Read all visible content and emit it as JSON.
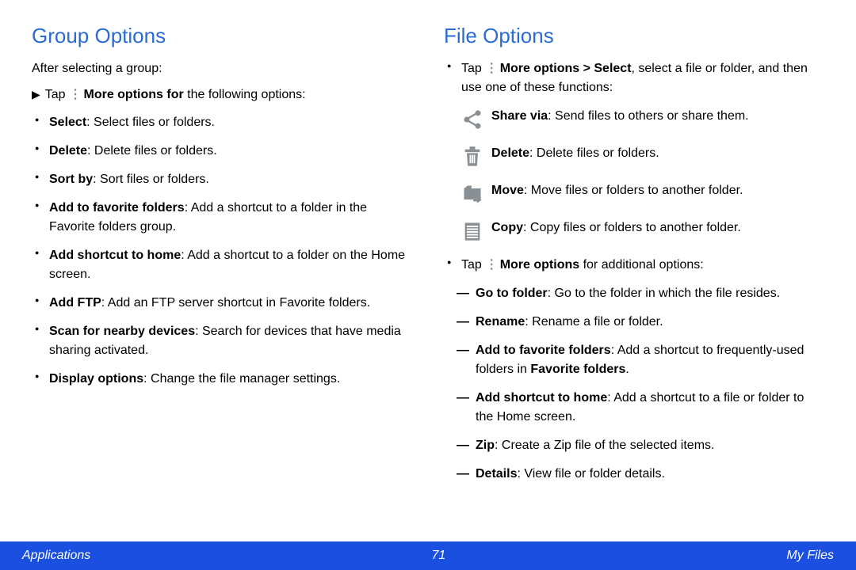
{
  "left": {
    "heading": "Group Options",
    "intro": "After selecting a group:",
    "tap_prefix": "Tap ",
    "tap_bold": "More options for",
    "tap_suffix": " the following options:",
    "items": [
      {
        "term": "Select",
        "desc": ": Select files or folders."
      },
      {
        "term": "Delete",
        "desc": ": Delete files or folders."
      },
      {
        "term": "Sort by",
        "desc": ": Sort files or folders."
      },
      {
        "term": "Add to favorite folders",
        "desc": ": Add a shortcut to a folder in the Favorite folders group."
      },
      {
        "term": "Add shortcut to home",
        "desc": ": Add a shortcut to a folder on the Home screen."
      },
      {
        "term": "Add FTP",
        "desc": ": Add an FTP server shortcut in Favorite folders."
      },
      {
        "term": "Scan for nearby devices",
        "desc": ": Search for devices that have media sharing activated."
      },
      {
        "term": "Display options",
        "desc": ": Change the file manager settings."
      }
    ]
  },
  "right": {
    "heading": "File Options",
    "top_tap_prefix": "Tap ",
    "top_tap_bold": "More options > Select",
    "top_tap_suffix": ", select a file or folder, and then use one of these functions:",
    "icon_items": [
      {
        "icon": "share-icon",
        "term": "Share via",
        "desc": ": Send files to others or share them."
      },
      {
        "icon": "trash-icon",
        "term": "Delete",
        "desc": ": Delete files or folders."
      },
      {
        "icon": "move-icon",
        "term": "Move",
        "desc": ": Move files or folders to another folder."
      },
      {
        "icon": "copy-icon",
        "term": "Copy",
        "desc": ": Copy files or folders to another folder."
      }
    ],
    "more_tap_prefix": "Tap ",
    "more_tap_bold": "More options",
    "more_tap_suffix": " for additional options:",
    "dash_items": [
      {
        "term": "Go to folder",
        "desc": ": Go to the folder in which the file resides."
      },
      {
        "term": "Rename",
        "desc": ": Rename a file or folder."
      },
      {
        "term": "Add to favorite folders",
        "desc": ": Add a shortcut to frequently-used folders in ",
        "tail_bold": "Favorite folders",
        "tail": "."
      },
      {
        "term": "Add shortcut to home",
        "desc": ": Add a shortcut to a file or folder to the Home screen."
      },
      {
        "term": "Zip",
        "desc": ": Create a Zip file of the selected items."
      },
      {
        "term": "Details",
        "desc": ": View file or folder details."
      }
    ]
  },
  "footer": {
    "left": "Applications",
    "center": "71",
    "right": "My Files"
  },
  "icons": {
    "more_dots": "⋮"
  }
}
